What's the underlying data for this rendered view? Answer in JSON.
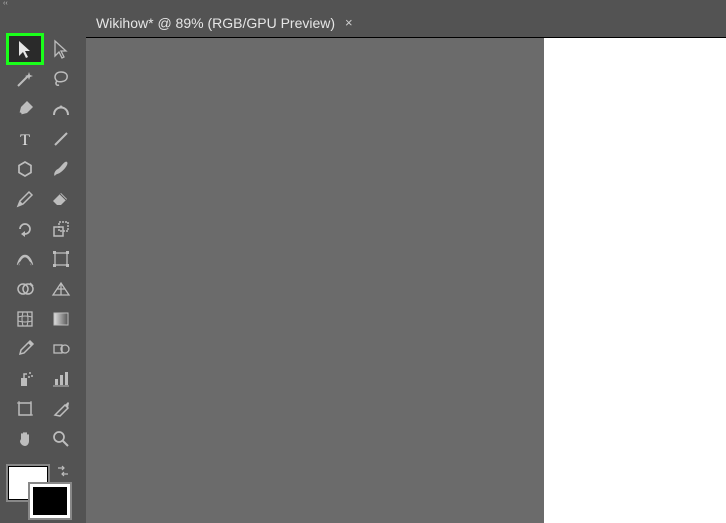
{
  "panel": {
    "collapse_glyph": "‹‹",
    "label": ""
  },
  "tab": {
    "title": "Wikihow* @ 89% (RGB/GPU Preview)",
    "close_glyph": "×"
  },
  "tools": {
    "selection": "Selection Tool",
    "direct_selection": "Direct Selection Tool",
    "magic_wand": "Magic Wand Tool",
    "lasso": "Lasso Tool",
    "pen": "Pen Tool",
    "curvature": "Curvature Tool",
    "type": "Type Tool",
    "line_segment": "Line Segment Tool",
    "shape": "Rectangle/Shape Tool",
    "paintbrush": "Paintbrush Tool",
    "pencil": "Pencil Tool",
    "eraser": "Eraser Tool",
    "rotate": "Rotate Tool",
    "scale": "Scale Tool",
    "width": "Width Tool",
    "free_transform": "Free Transform Tool",
    "shape_builder": "Shape Builder Tool",
    "perspective_grid": "Perspective Grid Tool",
    "mesh": "Mesh Tool",
    "gradient": "Gradient Tool",
    "eyedropper": "Eyedropper Tool",
    "blend": "Blend Tool",
    "symbol_sprayer": "Symbol Sprayer Tool",
    "column_graph": "Column Graph Tool",
    "artboard": "Artboard Tool",
    "slice": "Slice Tool",
    "hand": "Hand Tool",
    "zoom": "Zoom Tool"
  },
  "colors": {
    "fill": "#ffffff",
    "stroke": "#000000"
  }
}
